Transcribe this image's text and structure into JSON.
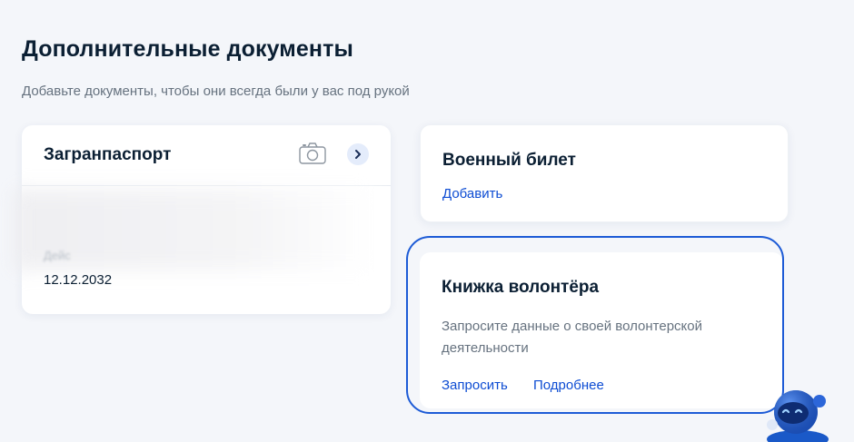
{
  "section": {
    "title": "Дополнительные документы",
    "subtitle": "Добавьте документы, чтобы они всегда были у вас под рукой"
  },
  "passport_card": {
    "name": "Загранпаспорт",
    "blurred_label": "Дейс",
    "date": "12.12.2032",
    "icons": [
      "camera-icon",
      "chevron-right-icon"
    ]
  },
  "military_card": {
    "name": "Военный билет",
    "add_link": "Добавить"
  },
  "volunteer_card": {
    "name": "Книжка волонтёра",
    "description": "Запросите данные о своей волонтерской деятельности",
    "request_link": "Запросить",
    "more_link": "Подробнее"
  },
  "assistant": {
    "icon": "robot-assistant-icon"
  },
  "colors": {
    "background": "#f4f6fa",
    "link": "#0d4cd3",
    "highlight": "#1d5bd6",
    "text": "#0b1f33",
    "muted": "#66727f"
  }
}
